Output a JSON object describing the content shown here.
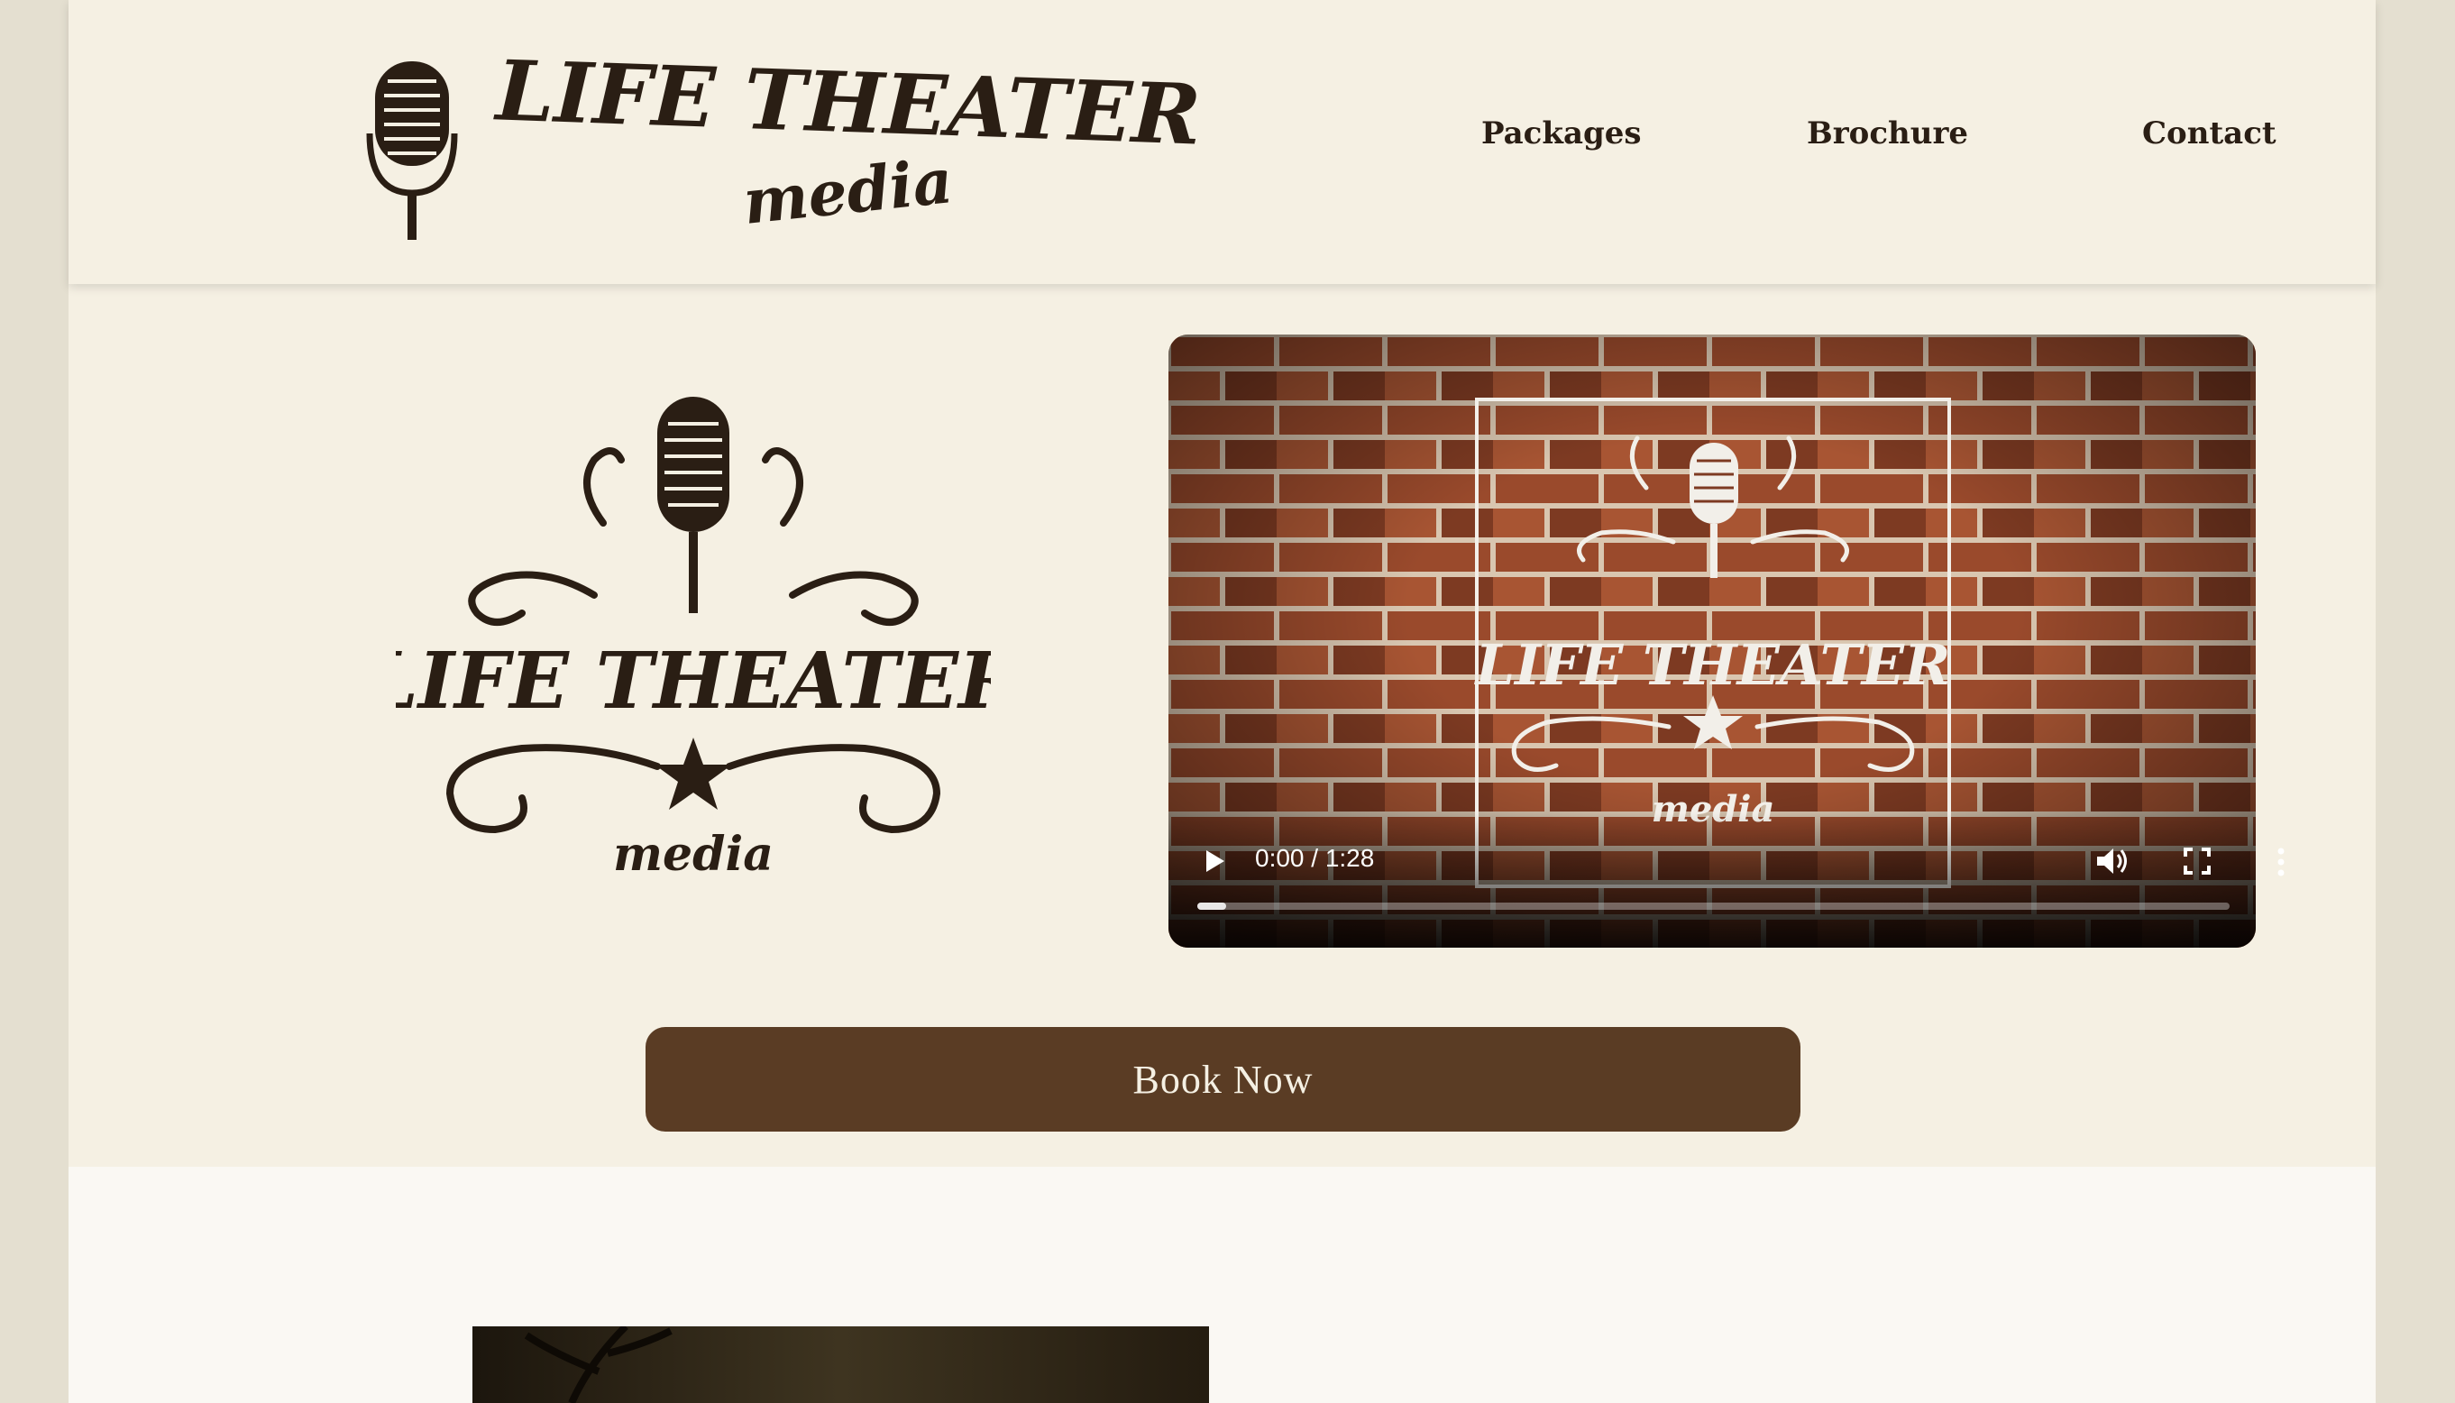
{
  "header": {
    "logo_name": "LIFE THEATER",
    "logo_sub": "media",
    "nav": {
      "packages": "Packages",
      "brochure": "Brochure",
      "contact": "Contact"
    }
  },
  "hero": {
    "logo_name": "LIFE THEATER",
    "logo_sub": "media"
  },
  "video": {
    "overlay_name": "LIFE THEATER",
    "overlay_sub": "media",
    "time": "0:00 / 1:28",
    "progress_fraction": 0
  },
  "cta": {
    "book_label": "Book Now"
  },
  "colors": {
    "page_bg": "#f5f0e3",
    "outer_bg": "#e4dfd0",
    "button_bg": "#5a3c24",
    "ink": "#2a1e14",
    "lower_bg": "#faf8f3"
  },
  "icons": {
    "play": "play-icon",
    "volume": "volume-icon",
    "fullscreen": "fullscreen-icon",
    "more": "more-vert-icon",
    "microphone": "microphone-icon",
    "star": "star-icon"
  }
}
